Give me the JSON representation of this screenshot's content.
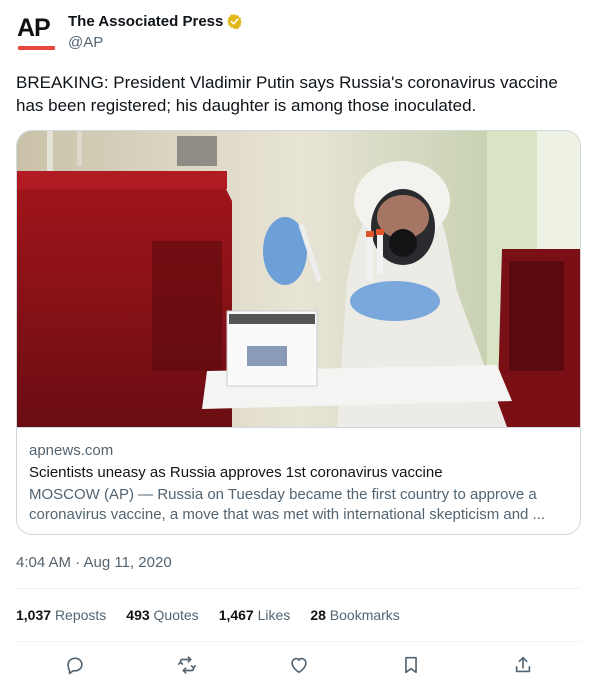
{
  "author": {
    "logo_text": "AP",
    "name": "The Associated Press",
    "handle": "@AP",
    "verified_badge": "gold-checkmark-badge",
    "badge_color": "#e2b719"
  },
  "tweet": {
    "text": "BREAKING: President Vladimir Putin says Russia's coronavirus vaccine has been registered; his daughter is among those inoculated."
  },
  "card": {
    "image": "scientist-in-protective-suit-photo",
    "domain": "apnews.com",
    "title": "Scientists uneasy as Russia approves 1st coronavirus vaccine",
    "description": "MOSCOW (AP) — Russia on Tuesday became the first country to approve a coronavirus vaccine, a move that was met with international skepticism and ..."
  },
  "timestamp": "4:04 AM · Aug 11, 2020",
  "stats": {
    "reposts_count": "1,037",
    "reposts_label": "Reposts",
    "quotes_count": "493",
    "quotes_label": "Quotes",
    "likes_count": "1,467",
    "likes_label": "Likes",
    "bookmarks_count": "28",
    "bookmarks_label": "Bookmarks"
  },
  "actions": [
    "reply-icon",
    "repost-icon",
    "like-icon",
    "bookmark-icon",
    "share-icon"
  ],
  "colors": {
    "text": "#0f1419",
    "secondary": "#536471",
    "border": "#cfd9de",
    "ap_red": "#e8453c"
  }
}
